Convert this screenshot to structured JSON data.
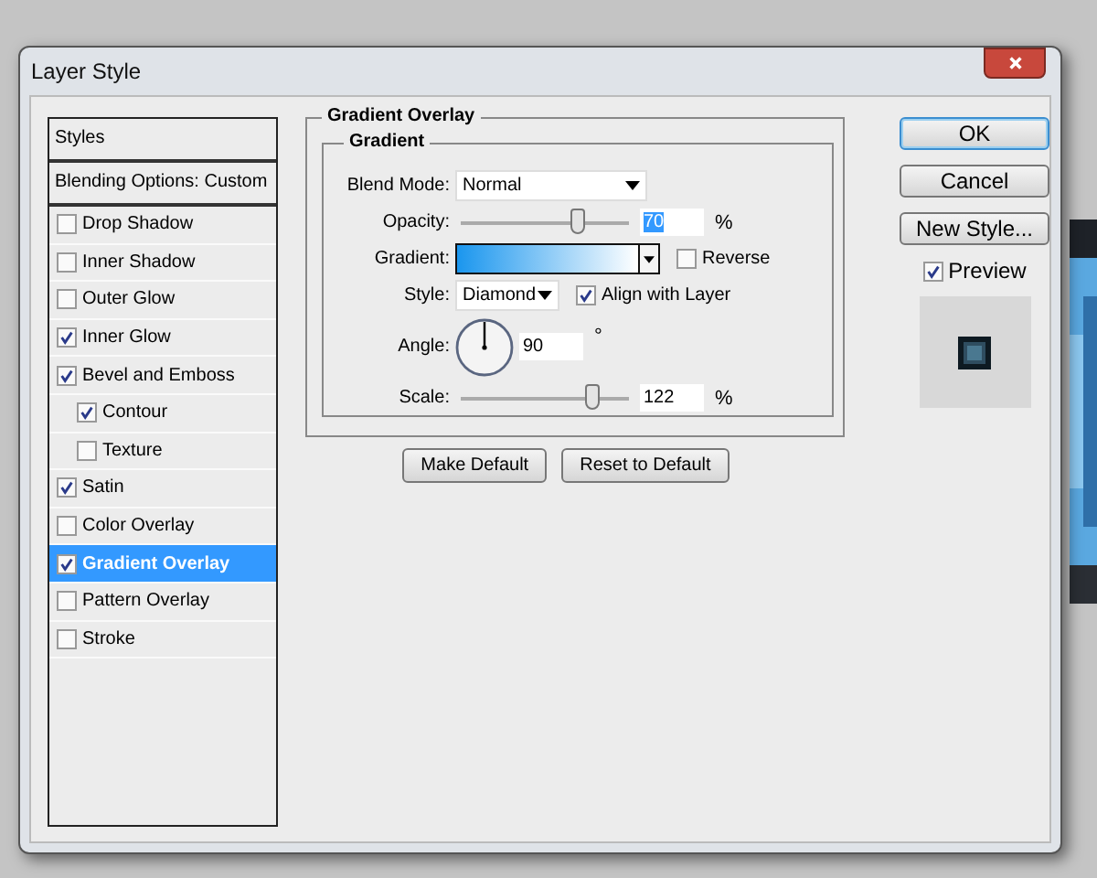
{
  "window": {
    "title": "Layer Style"
  },
  "styles_list": {
    "header": "Styles",
    "blending": "Blending Options: Custom",
    "items": [
      {
        "label": "Drop Shadow",
        "checked": false,
        "selected": false
      },
      {
        "label": "Inner Shadow",
        "checked": false,
        "selected": false
      },
      {
        "label": "Outer Glow",
        "checked": false,
        "selected": false
      },
      {
        "label": "Inner Glow",
        "checked": true,
        "selected": false
      },
      {
        "label": "Bevel and Emboss",
        "checked": true,
        "selected": false,
        "children": [
          {
            "label": "Contour",
            "checked": true,
            "selected": false
          },
          {
            "label": "Texture",
            "checked": false,
            "selected": false
          }
        ]
      },
      {
        "label": "Satin",
        "checked": true,
        "selected": false
      },
      {
        "label": "Color Overlay",
        "checked": false,
        "selected": false
      },
      {
        "label": "Gradient Overlay",
        "checked": true,
        "selected": true
      },
      {
        "label": "Pattern Overlay",
        "checked": false,
        "selected": false
      },
      {
        "label": "Stroke",
        "checked": false,
        "selected": false
      }
    ]
  },
  "panel": {
    "title": "Gradient Overlay",
    "group_title": "Gradient",
    "blend_mode": {
      "label": "Blend Mode:",
      "value": "Normal"
    },
    "opacity": {
      "label": "Opacity:",
      "level": 0.7,
      "value": "70",
      "unit": "%"
    },
    "gradient": {
      "label": "Gradient:"
    },
    "reverse": {
      "label": "Reverse",
      "checked": false
    },
    "style": {
      "label": "Style:",
      "value": "Diamond"
    },
    "align": {
      "label": "Align with Layer",
      "checked": true
    },
    "angle": {
      "label": "Angle:",
      "value": "90",
      "unit": "°"
    },
    "scale": {
      "label": "Scale:",
      "level": 0.78,
      "value": "122",
      "unit": "%"
    },
    "buttons": [
      "Make Default",
      "Reset to Default"
    ]
  },
  "actions": {
    "buttons": [
      "OK",
      "Cancel",
      "New Style..."
    ],
    "preview": {
      "label": "Preview",
      "checked": true
    }
  }
}
